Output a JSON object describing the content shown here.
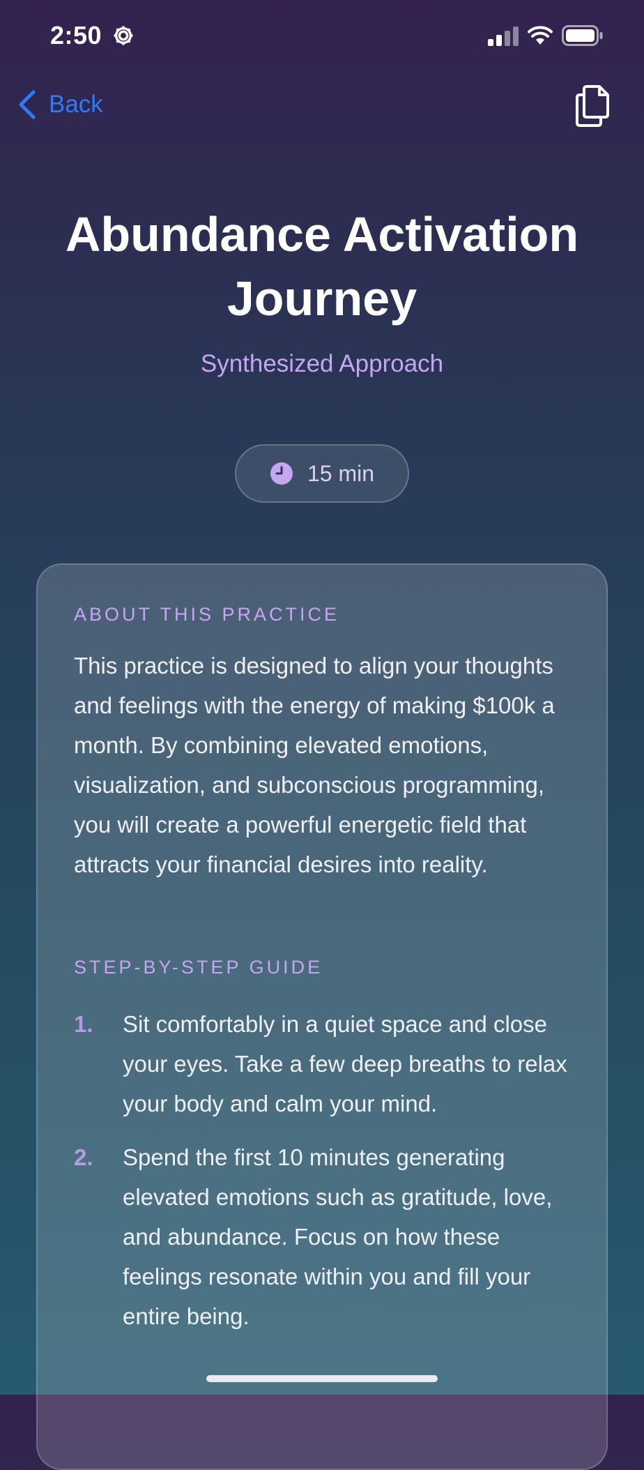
{
  "status_bar": {
    "time": "2:50"
  },
  "nav": {
    "back_label": "Back"
  },
  "header": {
    "title": "Abundance Activation Journey",
    "subtitle": "Synthesized Approach",
    "duration": "15 min"
  },
  "about": {
    "heading": "ABOUT THIS PRACTICE",
    "body": "This practice is designed to align your thoughts and feelings with the energy of making $100k a month. By combining elevated emotions, visualization, and subconscious programming, you will create a powerful energetic field that attracts your financial desires into reality."
  },
  "guide": {
    "heading": "STEP-BY-STEP GUIDE",
    "steps": [
      {
        "number": "1.",
        "text": "Sit comfortably in a quiet space and close your eyes. Take a few deep breaths to relax your body and calm your mind."
      },
      {
        "number": "2.",
        "text": "Spend the first 10 minutes generating elevated emotions such as gratitude, love, and abundance. Focus on how these feelings resonate within you and fill your entire being."
      }
    ]
  },
  "colors": {
    "accent_blue": "#2f7bf5",
    "accent_purple": "#c6a6f3"
  }
}
